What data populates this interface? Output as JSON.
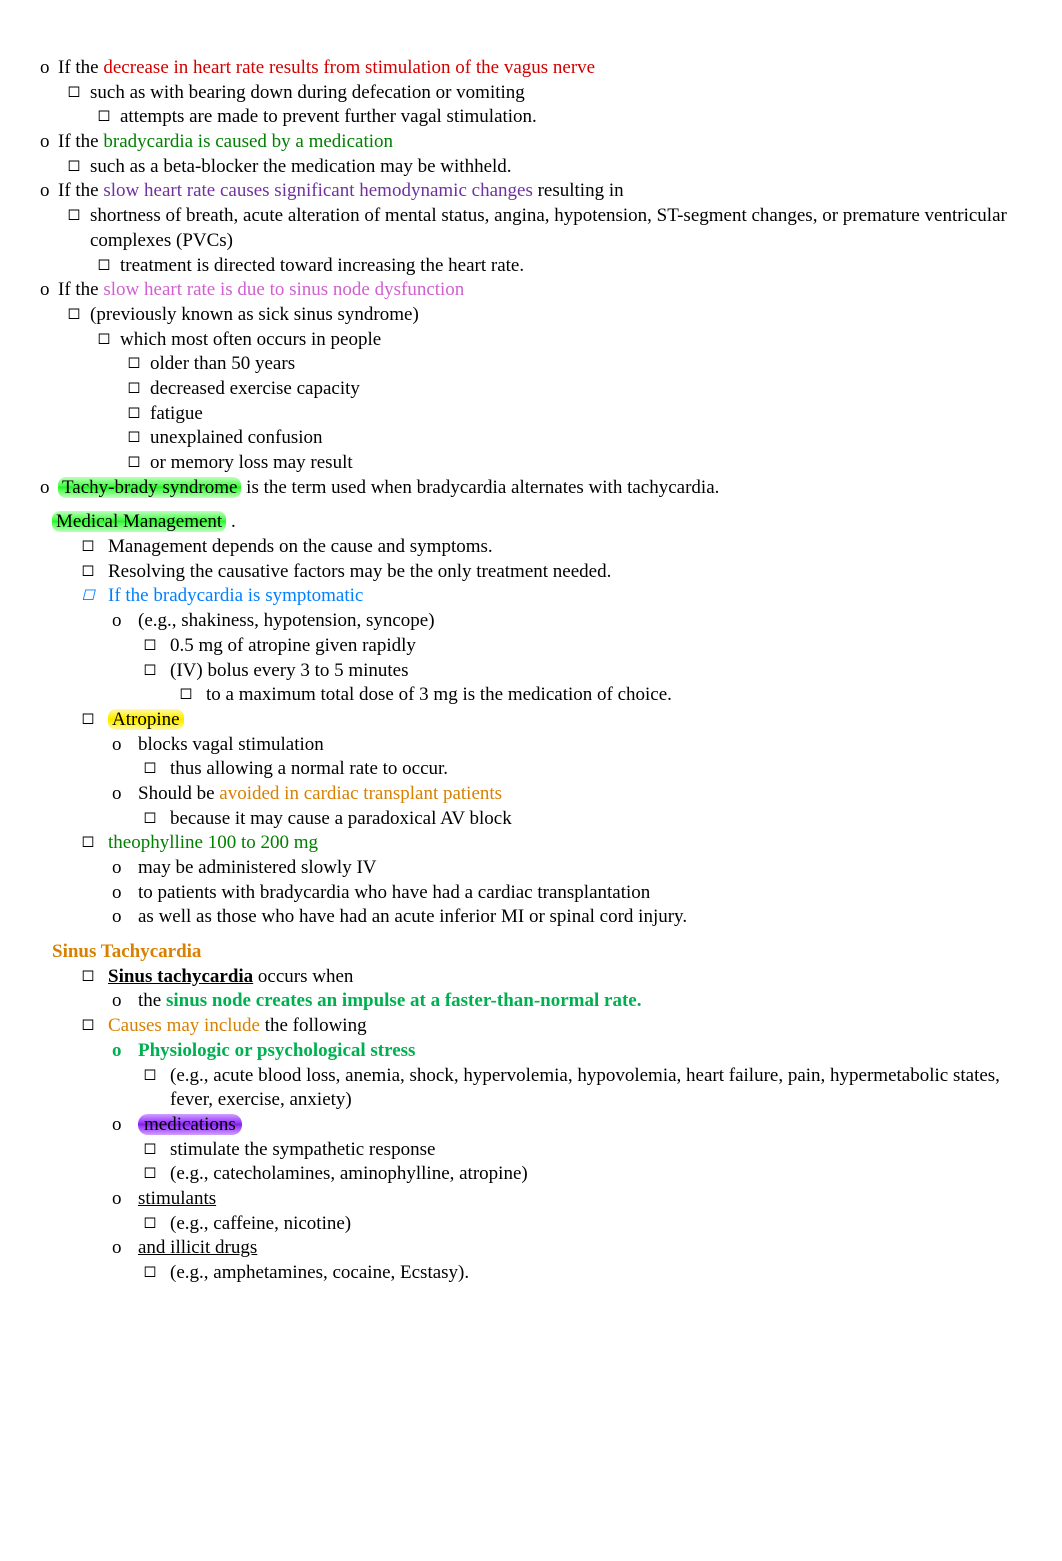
{
  "s1": {
    "r1": {
      "pre": "If the ",
      "hl": "decrease in heart rate results from stimulation of the vagus nerve"
    },
    "r1a": "such as with bearing down during defecation or vomiting",
    "r1b": "attempts are made to prevent further vagal stimulation.",
    "r2": {
      "pre": "If the ",
      "hl": "bradycardia is caused by a medication"
    },
    "r2a": "such as a beta-blocker the medication may be withheld.",
    "r3": {
      "pre": "If the ",
      "hl": "slow heart rate causes significant hemodynamic changes",
      "post": "   resulting in"
    },
    "r3a": "shortness of breath, acute alteration of mental status, angina, hypotension, ST-segment changes, or premature ventricular complexes (PVCs)",
    "r3b": "treatment is directed toward  increasing the heart rate.",
    "r4": {
      "pre": "If the ",
      "hl": "slow heart rate is due to sinus node dysfunction"
    },
    "r4a": "(previously known as sick sinus syndrome)",
    "r4b": "which most often occurs in people",
    "r4b_i": [
      "older than 50 years",
      "decreased exercise capacity",
      "fatigue",
      "unexplained confusion",
      "or memory loss may result"
    ],
    "r5": {
      "hl": "Tachy-brady syndrome",
      "post": " is the term used when bradycardia alternates with tachycardia."
    }
  },
  "mm": {
    "heading": "Medical Management",
    "heading_post": " .",
    "m1": "Management depends on the cause and symptoms.",
    "m2": "Resolving the causative factors may be the only treatment needed.",
    "m3": "If the bradycardia is symptomatic",
    "m3o": "(e.g., shakiness, hypotension, syncope)",
    "m3a": "0.5 mg of atropine given rapidly",
    "m3b": "(IV) bolus every 3 to 5 minutes",
    "m3c": "to a maximum total dose of 3 mg is the medication of choice.",
    "m4": "Atropine",
    "m4a": "blocks vagal stimulation",
    "m4a1": "thus allowing a normal rate to occur.",
    "m4b_pre": "Should be ",
    "m4b_hl": "avoided in cardiac transplant patients",
    "m4b1": "because it may cause a paradoxical AV block",
    "m5": "theophylline 100 to 200 mg",
    "m5a": "may be administered slowly IV",
    "m5b": "to patients with bradycardia who have had a cardiac transplantation",
    "m5c": "as well as those who have had an acute inferior MI or spinal cord injury."
  },
  "st": {
    "heading": "Sinus Tachycardia",
    "r1": {
      "a": "Sinus tachycardia",
      "b": " occurs when"
    },
    "r1a": {
      "a": "the ",
      "b": "sinus node creates an impulse at a faster-than-normal rate."
    },
    "r2": {
      "a": "Causes may include ",
      "b": "the following"
    },
    "r2a": "Physiologic or psychological stress",
    "r2a_i": "(e.g., acute blood loss, anemia, shock, hypervolemia, hypovolemia, heart failure, pain, hypermetabolic states, fever, exercise, anxiety)",
    "r2b": "medications",
    "r2b_i": "stimulate the sympathetic response",
    "r2b_ii": "(e.g., catecholamines, aminophylline, atropine)",
    "r2c": "stimulants",
    "r2c_i": "(e.g., caffeine, nicotine)",
    "r2d": "and illicit drugs",
    "r2d_i": "(e.g., amphetamines, cocaine, Ecstasy)."
  }
}
